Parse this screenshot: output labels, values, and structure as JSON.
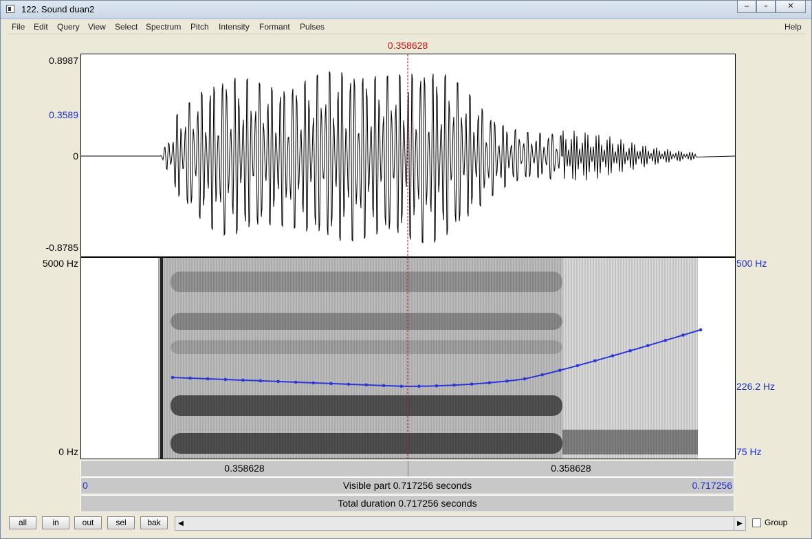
{
  "window": {
    "title": "122. Sound duan2",
    "controls": {
      "minimize": "‒",
      "restore": "▫",
      "close": "✕"
    }
  },
  "menu": [
    "File",
    "Edit",
    "Query",
    "View",
    "Select",
    "Spectrum",
    "Pitch",
    "Intensity",
    "Formant",
    "Pulses"
  ],
  "menu_help": "Help",
  "cursor": {
    "time_label": "0.358628",
    "position_fraction": 0.5
  },
  "waveform": {
    "y_max": "0.8987",
    "y_cursor": "0.3589",
    "y_zero": "0",
    "y_min": "-0.8785"
  },
  "spectrogram": {
    "freq_max": "5000 Hz",
    "freq_min": "0 Hz",
    "pitch_max": "500 Hz",
    "pitch_cursor": "226.2 Hz",
    "pitch_min": "75 Hz",
    "pitch_color": "#2a36d8"
  },
  "time_bars": {
    "left_segment": "0.358628",
    "right_segment": "0.358628",
    "visible_start": "0",
    "visible_text": "Visible part 0.717256 seconds",
    "visible_end": "0.717256",
    "total_text": "Total duration 0.717256 seconds"
  },
  "buttons": {
    "all": "all",
    "in": "in",
    "out": "out",
    "sel": "sel",
    "bak": "bak"
  },
  "scroll_left_icon": "scroll-left-arrow",
  "scroll_right_icon": "scroll-right-arrow",
  "group_label": "Group",
  "group_checked": false
}
